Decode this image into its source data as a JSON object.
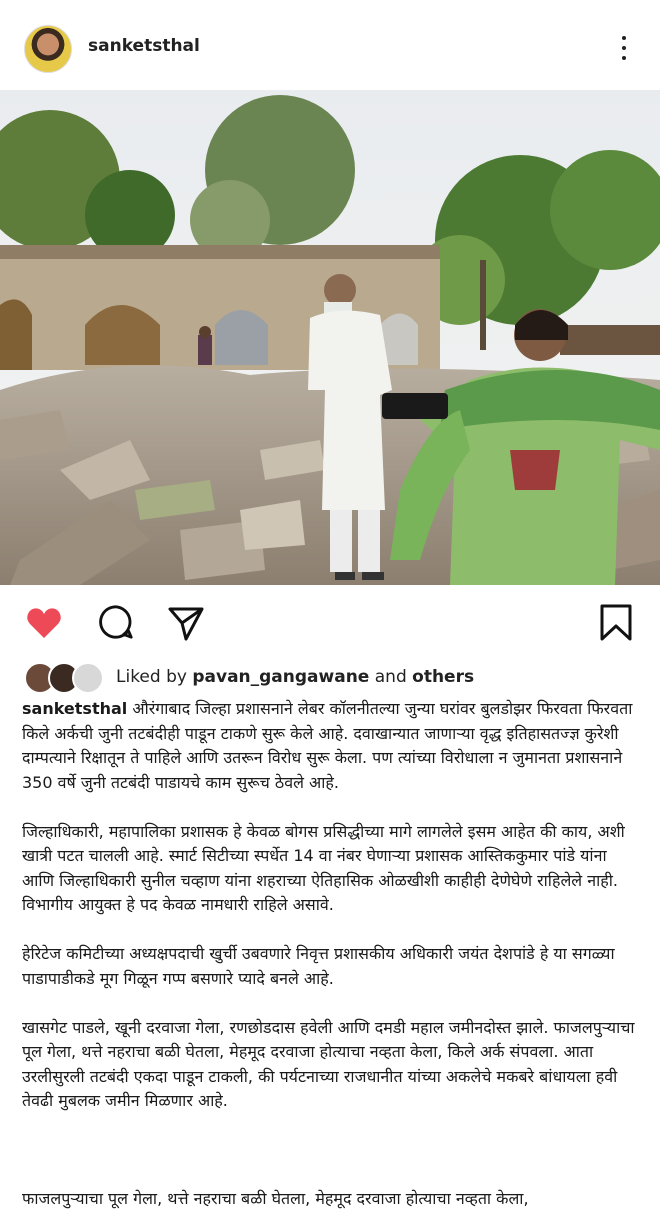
{
  "header": {
    "username": "sanketsthal",
    "avatar_icon": "profile-photo",
    "more_icon": "more-vertical-icon"
  },
  "actions": {
    "like_color": "#ed4956",
    "like_icon": "heart-filled-icon",
    "comment_icon": "comment-icon",
    "share_icon": "send-icon",
    "save_icon": "bookmark-icon"
  },
  "likes": {
    "prefix": "Liked by ",
    "user": "pavan_gangawane",
    "joiner": " and ",
    "others": "others"
  },
  "caption": {
    "username": "sanketsthal",
    "p1": "औरंगाबाद जिल्हा प्रशासनाने लेबर कॉलनीतल्या जुन्या घरांवर बुलडोझर फिरवता फिरवता किले अर्कची जुनी तटबंदीही पाडून टाकणे सुरू केले आहे. दवाखान्यात जाणाऱ्या वृद्ध इतिहासतज्ज्ञ कुरेशी दाम्पत्याने रिक्षातून ते पाहिले आणि उतरून विरोध सुरू केला. पण त्यांच्या विरोधाला न जुमानता प्रशासनाने 350 वर्षे जुनी तटबंदी पाडायचे काम सुरूच ठेवले आहे.",
    "p2": "जिल्हाधिकारी, महापालिका प्रशासक हे केवळ बोगस प्रसिद्धीच्या मागे लागलेले इसम आहेत की काय, अशी खात्री पटत चालली आहे. स्मार्ट सिटीच्या स्पर्धेत 14 वा नंबर घेणाऱ्या प्रशासक आस्तिककुमार पांडे यांना आणि जिल्हाधिकारी सुनील चव्हाण यांना शहराच्या ऐतिहासिक ओळखीशी काहीही देणेघेणे राहिलेले नाही. विभागीय आयुक्त हे पद केवळ नामधारी राहिले असावे.",
    "p3": "हेरिटेज कमिटीच्या अध्यक्षपदाची खुर्ची उबवणारे निवृत्त प्रशासकीय अधिकारी जयंत देशपांडे हे या सगळ्या पाडापाडीकडे मूग गिळून गप्प बसणारे प्यादे बनले आहे.",
    "p4": "खासगेट पाडले, खूनी दरवाजा गेला, रणछोडदास हवेली आणि दमडी महाल जमीनदोस्त झाले. फाजलपुऱ्याचा पूल गेला, थत्ते नहराचा बळी घेतला, मेहमूद दरवाजा होत्याचा नव्हता केला, किले अर्क संपवला. आता उरलीसुरली तटबंदी एकदा पाडून टाकली, की पर्यटनाच्या राजधानीत यांच्या अकलेचे मकबरे बांधायला हवी तेवढी मुबलक जमीन मिळणार आहे.",
    "p5_cutoff": "फाजलपुऱ्याचा पूल गेला, थत्ते नहराचा बळी घेतला, मेहमूद दरवाजा होत्याचा नव्हता केला,"
  }
}
